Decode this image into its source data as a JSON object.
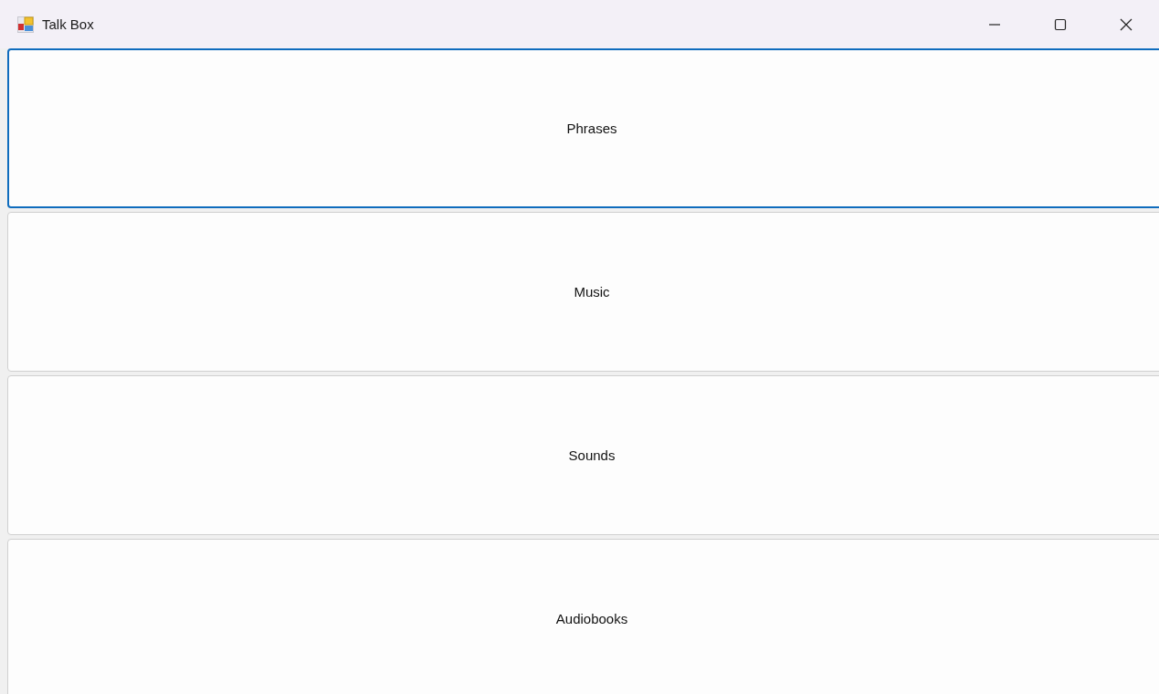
{
  "window": {
    "title": "Talk Box"
  },
  "buttons": [
    {
      "label": "Phrases",
      "focused": true
    },
    {
      "label": "Music",
      "focused": false
    },
    {
      "label": "Sounds",
      "focused": false
    },
    {
      "label": "Audiobooks",
      "focused": false
    }
  ]
}
